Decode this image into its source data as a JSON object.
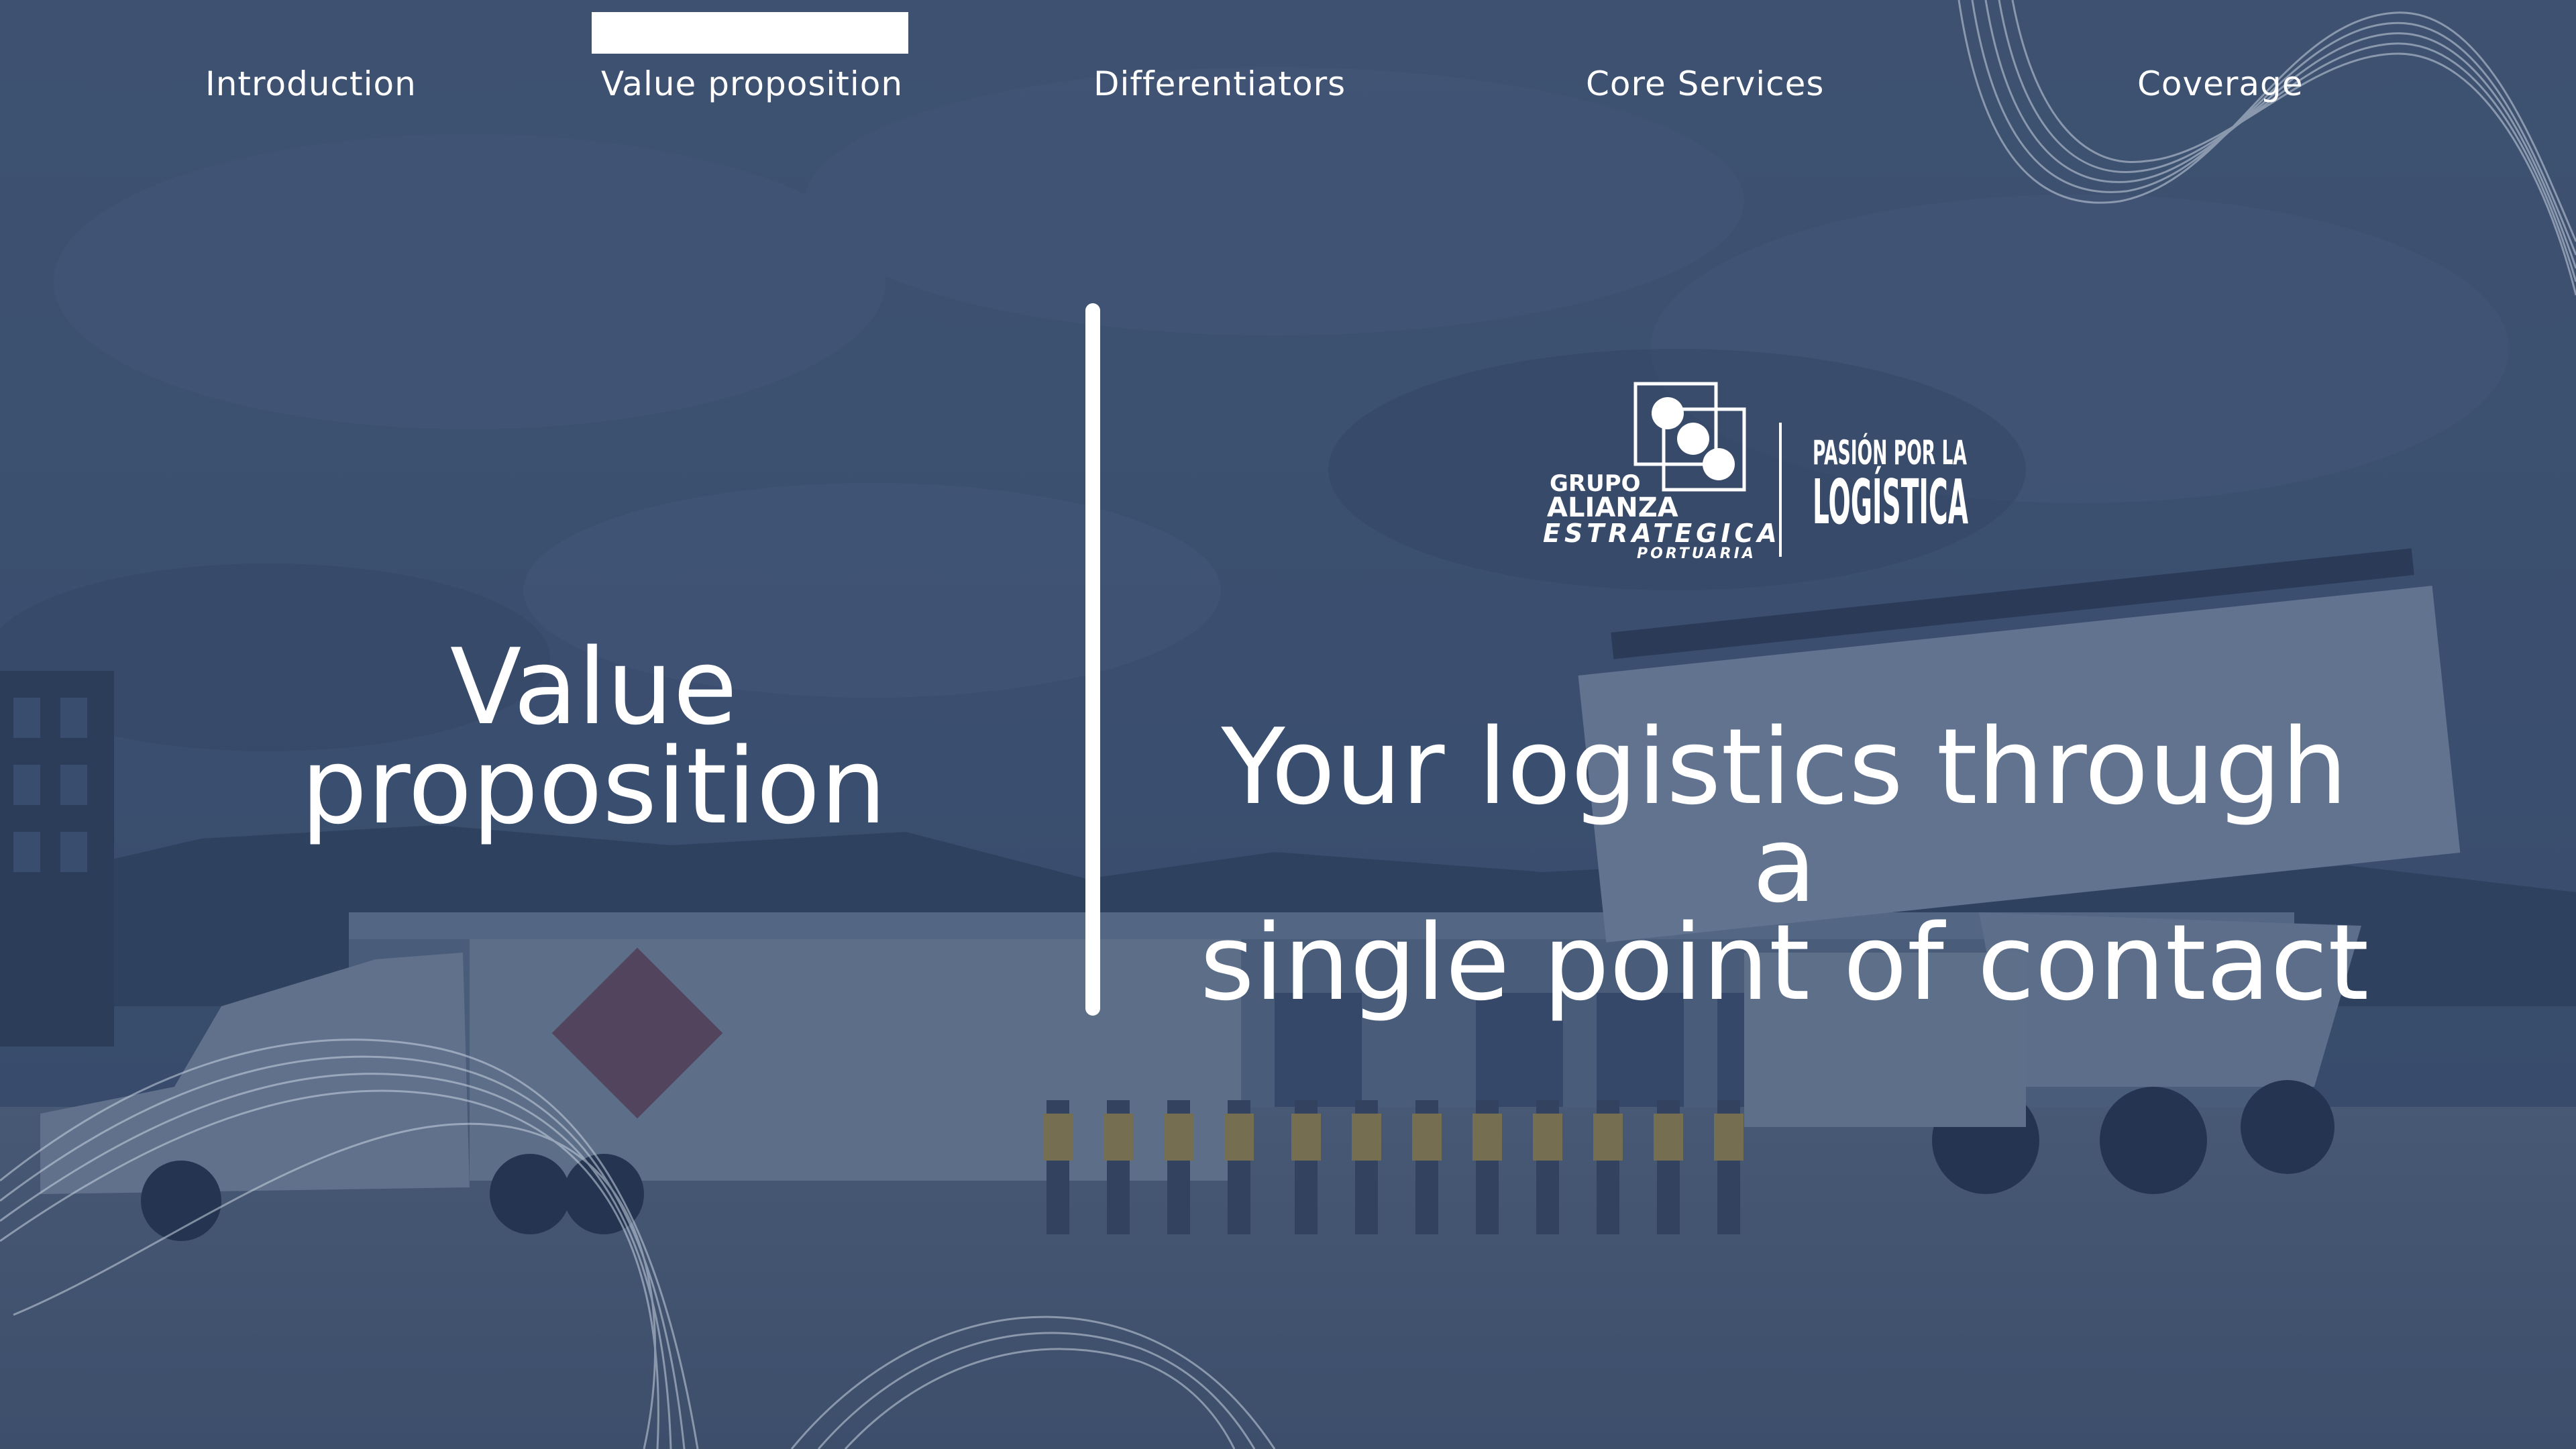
{
  "nav": {
    "items": [
      {
        "label": "Introduction"
      },
      {
        "label": "Value proposition"
      },
      {
        "label": "Differentiators"
      },
      {
        "label": "Core Services"
      },
      {
        "label": "Coverage"
      }
    ],
    "active_index": 1
  },
  "slide": {
    "title_lines": [
      "Value",
      "proposition"
    ],
    "tagline_lines": [
      "Your logistics through a",
      "single point of contact"
    ]
  },
  "logo": {
    "grupo": "GRUPO",
    "alianza": "ALIANZA",
    "estrategica": "ESTRATEGICA",
    "portuaria": "PORTUARIA",
    "slogan_line1": "PASIÓN POR LA",
    "slogan_line2": "LOGÍSTICA"
  },
  "colors": {
    "overlay": "#263a5c",
    "text": "#ffffff",
    "sky": "#4a5d78"
  }
}
